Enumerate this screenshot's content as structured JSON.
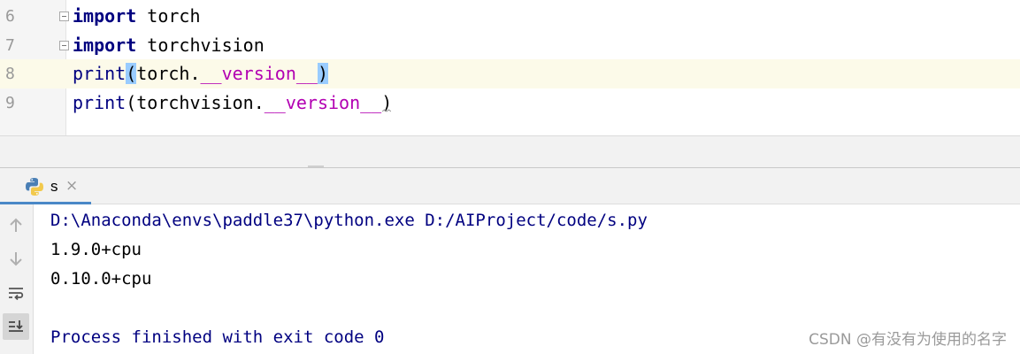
{
  "editor": {
    "lines": [
      {
        "num": "6",
        "parts": [
          {
            "t": "import",
            "c": "kw"
          },
          {
            "t": " torch",
            "c": "plain"
          }
        ]
      },
      {
        "num": "7",
        "parts": [
          {
            "t": "import",
            "c": "kw"
          },
          {
            "t": " torchvision",
            "c": "plain"
          }
        ]
      },
      {
        "num": "8",
        "parts": [
          {
            "t": "print",
            "c": "fn"
          },
          {
            "t": "(",
            "c": "brace"
          },
          {
            "t": "torch.",
            "c": "plain"
          },
          {
            "t": "__version__",
            "c": "dunder"
          },
          {
            "t": ")",
            "c": "brace"
          }
        ]
      },
      {
        "num": "9",
        "parts": [
          {
            "t": "print",
            "c": "fn"
          },
          {
            "t": "(torchvision.",
            "c": "plain"
          },
          {
            "t": "__version__",
            "c": "dunder"
          },
          {
            "t": ")",
            "c": "plain"
          }
        ]
      }
    ],
    "current_line": "8"
  },
  "run_panel": {
    "tab_label": "s",
    "tab_close": "×",
    "tab_icon": "python-icon",
    "toolbar_icons": [
      "arrow-up-icon",
      "arrow-down-icon",
      "soft-wrap-icon",
      "scroll-to-end-icon"
    ]
  },
  "console": {
    "command": "D:\\Anaconda\\envs\\paddle37\\python.exe D:/AIProject/code/s.py",
    "output1": "1.9.0+cpu",
    "output2": "0.10.0+cpu",
    "exit_message": "Process finished with exit code 0"
  },
  "watermark": "CSDN @有没有为使用的名字",
  "colors": {
    "keyword": "#000080",
    "dunder": "#b200b2",
    "brace_highlight": "#99ccff",
    "current_line": "#fcfae9",
    "tab_underline": "#4a88c7"
  }
}
